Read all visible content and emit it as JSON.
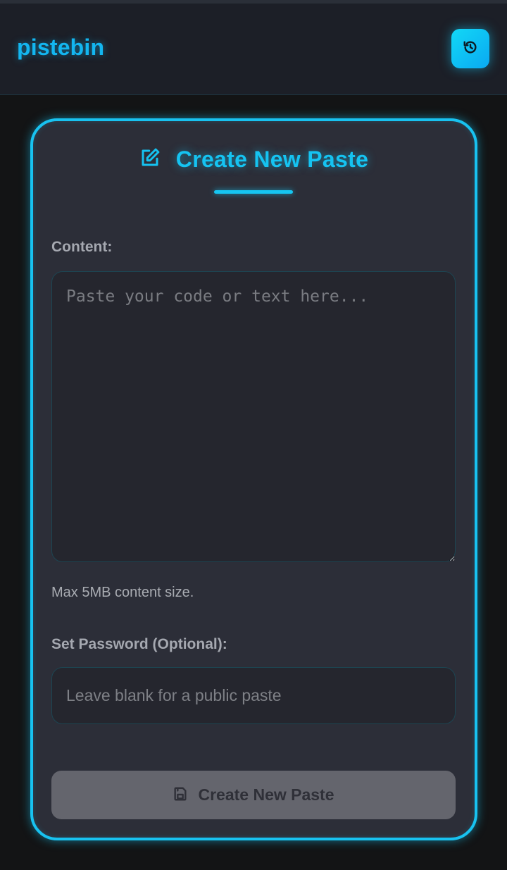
{
  "header": {
    "brand": "pistebin",
    "history_icon": "history-icon"
  },
  "form": {
    "title": "Create New Paste",
    "title_icon": "edit-icon",
    "content_label": "Content:",
    "content_placeholder": "Paste your code or text here...",
    "content_value": "",
    "content_hint": "Max 5MB content size.",
    "password_label": "Set Password (Optional):",
    "password_placeholder": "Leave blank for a public paste",
    "password_value": "",
    "submit_label": "Create New Paste",
    "submit_icon": "save-icon"
  },
  "colors": {
    "accent": "#15c3f1",
    "background": "#131415",
    "card": "#2c2e38",
    "submit_disabled": "#64656d"
  }
}
